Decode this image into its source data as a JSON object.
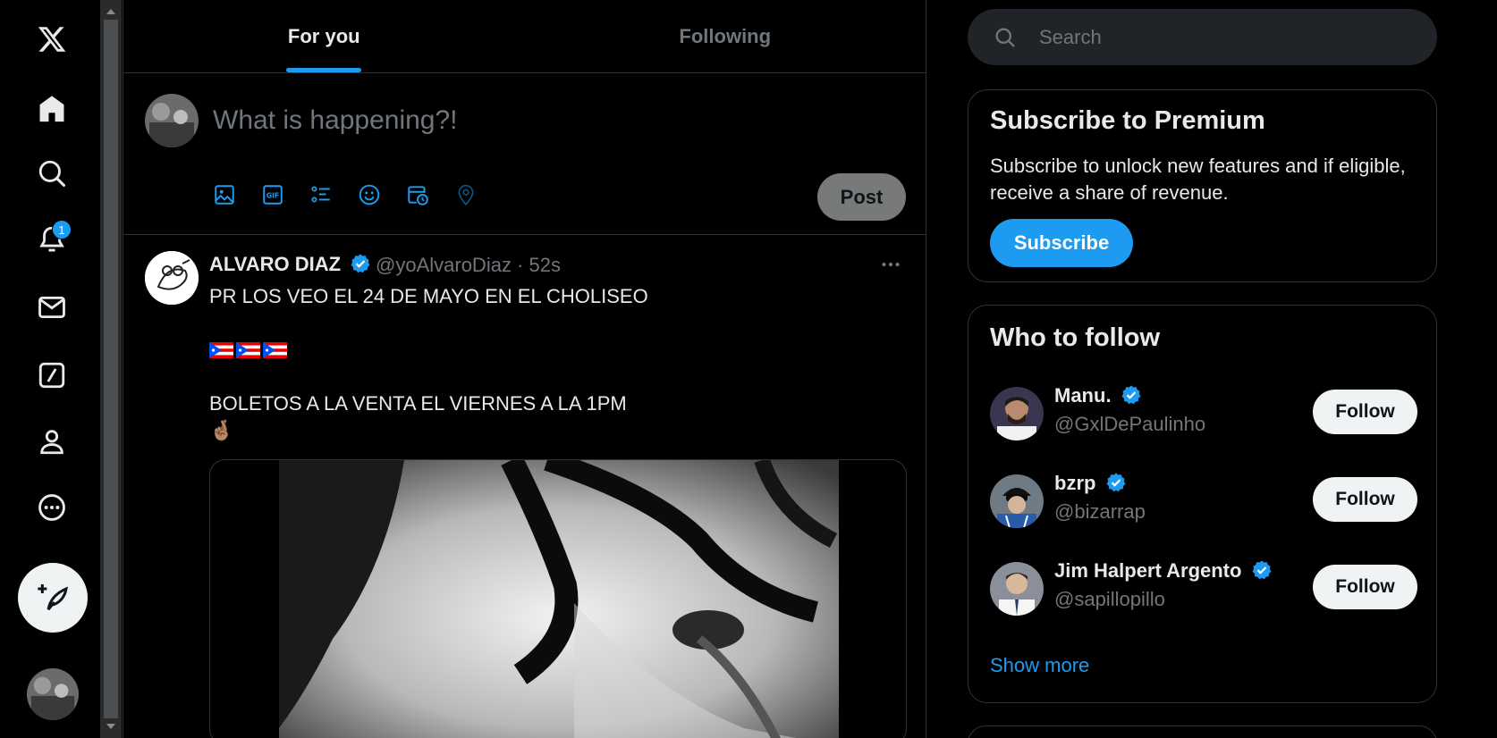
{
  "nav": {
    "items": [
      {
        "icon": "x-logo-icon"
      },
      {
        "icon": "home-icon"
      },
      {
        "icon": "search-icon"
      },
      {
        "icon": "bell-icon",
        "badge": "1"
      },
      {
        "icon": "mail-icon"
      },
      {
        "icon": "grok-icon"
      },
      {
        "icon": "profile-icon"
      },
      {
        "icon": "more-circle-icon"
      }
    ],
    "compose_icon": "feather-plus-icon"
  },
  "tabs": [
    {
      "label": "For you",
      "active": true
    },
    {
      "label": "Following",
      "active": false
    }
  ],
  "composer": {
    "placeholder": "What is happening?!",
    "tools": [
      "image-icon",
      "gif-icon",
      "poll-icon",
      "emoji-icon",
      "schedule-icon",
      "location-icon"
    ],
    "post_label": "Post"
  },
  "tweet": {
    "name": "ALVARO DIAZ",
    "handle_time": "@yoAlvaroDiaz · 52s",
    "line1": "PR LOS VEO EL 24 DE MAYO EN EL CHOLISEO",
    "flags": "🇵🇷🇵🇷🇵🇷",
    "line3": "BOLETOS A LA VENTA EL VIERNES A LA 1PM",
    "line4": "🤞🏽"
  },
  "search": {
    "placeholder": "Search"
  },
  "premium": {
    "title": "Subscribe to Premium",
    "text": "Subscribe to unlock new features and if eligible, receive a share of revenue.",
    "button": "Subscribe"
  },
  "who_to_follow": {
    "title": "Who to follow",
    "people": [
      {
        "name": "Manu.",
        "handle": "@GxlDePaulinho",
        "button": "Follow"
      },
      {
        "name": "bzrp",
        "handle": "@bizarrap",
        "button": "Follow"
      },
      {
        "name": "Jim Halpert Argento",
        "handle": "@sapillopillo",
        "button": "Follow"
      }
    ],
    "show_more": "Show more"
  },
  "colors": {
    "accent": "#1d9bf0",
    "background": "#000000",
    "muted": "#71767b",
    "border": "#2f3336"
  }
}
